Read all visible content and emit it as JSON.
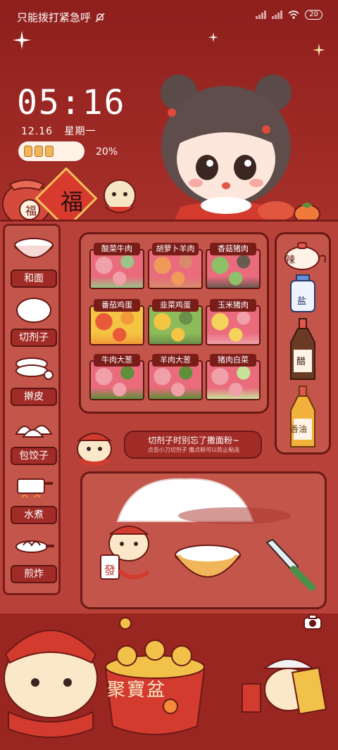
{
  "status_bar": {
    "carrier_text": "只能拨打紧急呼",
    "battery_level": "20"
  },
  "lockscreen": {
    "time": "05:16",
    "date": "12.16",
    "weekday": "星期一",
    "battery_percent": "20%",
    "battery_fraction": 0.2
  },
  "decor": {
    "fu_char": "福",
    "jubaopen": "聚寶盆",
    "fa_char": "發",
    "spice_chili": "辣",
    "spice_salt": "盐",
    "spice_vinegar": "醋",
    "spice_oil": "香油"
  },
  "sidebar": {
    "items": [
      {
        "label": "和面",
        "icon": "flour-bowl-icon"
      },
      {
        "label": "切剂子",
        "icon": "dough-ball-icon"
      },
      {
        "label": "擀皮",
        "icon": "dough-wrapper-icon"
      },
      {
        "label": "包饺子",
        "icon": "dumplings-icon"
      },
      {
        "label": "水煮",
        "icon": "pot-icon"
      },
      {
        "label": "煎炸",
        "icon": "frying-pan-icon"
      }
    ]
  },
  "fillings": [
    {
      "label": "酸菜牛肉",
      "colors": [
        "#e96b7c",
        "#f0a0a8",
        "#9cc38a"
      ]
    },
    {
      "label": "胡萝卜羊肉",
      "colors": [
        "#e96b7c",
        "#f09a5a",
        "#d88b6c"
      ]
    },
    {
      "label": "香菇猪肉",
      "colors": [
        "#e96b7c",
        "#8ec06a",
        "#6b5a50"
      ]
    },
    {
      "label": "番茄鸡蛋",
      "colors": [
        "#f4c542",
        "#e85a3a",
        "#f29a3a"
      ]
    },
    {
      "label": "韭菜鸡蛋",
      "colors": [
        "#8dbb5a",
        "#f4c542",
        "#6b8f4a"
      ]
    },
    {
      "label": "玉米猪肉",
      "colors": [
        "#e96b7c",
        "#f4d35a",
        "#f0a0a8"
      ]
    },
    {
      "label": "牛肉大葱",
      "colors": [
        "#e96b7c",
        "#f0a0a8",
        "#5e8f3a"
      ]
    },
    {
      "label": "羊肉大葱",
      "colors": [
        "#e96b7c",
        "#f0a0a8",
        "#5e8f3a"
      ]
    },
    {
      "label": "猪肉白菜",
      "colors": [
        "#e96b7c",
        "#f0a0a8",
        "#c9e29a"
      ]
    }
  ],
  "tip": {
    "title": "切剂子时别忘了撒面粉~",
    "subtitle": "点击小刀切剂子 撒点粉可以防止粘连"
  },
  "colors": {
    "background": "#9a2622",
    "panel": "#c4554b",
    "outline": "#6b1915",
    "label_bg": "#7a1d19"
  }
}
